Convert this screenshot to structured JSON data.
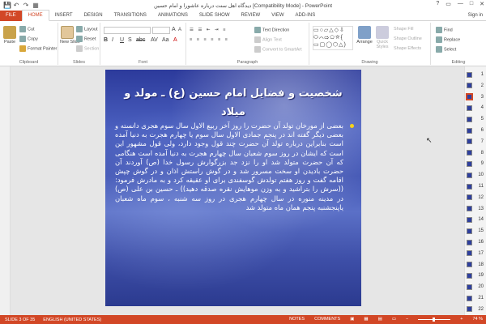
{
  "window": {
    "title": "دیدگاه اهل سنت درباره عاشورا و امام حسین [Compatibility Mode] - PowerPoint",
    "controls": [
      "?",
      "▭",
      "—",
      "□",
      "✕"
    ]
  },
  "qat": [
    "💾",
    "↶",
    "↷",
    "▦"
  ],
  "tabs": [
    "FILE",
    "HOME",
    "INSERT",
    "DESIGN",
    "TRANSITIONS",
    "ANIMATIONS",
    "SLIDE SHOW",
    "REVIEW",
    "VIEW",
    "ADD-INS"
  ],
  "signin": "Sign in",
  "ribbon": {
    "clipboard": {
      "paste": "Paste",
      "cut": "Cut",
      "copy": "Copy",
      "format_painter": "Format Painter",
      "label": "Clipboard"
    },
    "slides": {
      "new_slide": "New Slide",
      "layout": "Layout",
      "reset": "Reset",
      "section": "Section",
      "label": "Slides"
    },
    "font": {
      "label": "Font"
    },
    "paragraph": {
      "text_direction": "Text Direction",
      "align_text": "Align Text",
      "convert_smartart": "Convert to SmartArt",
      "label": "Paragraph"
    },
    "drawing": {
      "arrange": "Arrange",
      "quick_styles": "Quick Styles",
      "shape_fill": "Shape Fill",
      "shape_outline": "Shape Outline",
      "shape_effects": "Shape Effects",
      "label": "Drawing"
    },
    "editing": {
      "find": "Find",
      "replace": "Replace",
      "select": "Select",
      "label": "Editing"
    }
  },
  "slide": {
    "title": "شخصیت و فضایل امام حسین (ع) ـ مولد و میلاد",
    "body": "بعضی از مورخان تولد آن حضرت را روز آخر ربیع الاول سال سوم هجری دانسته و بعضی دیگر گفته اند در پنجم جمادی الاول سال سوم یا چهارم هجرت به دنیا آمده است بنابراین درباره تولد آن حضرت چند قول وجود دارد، ولی قول مشهور این است که ایشان در روز سوم شعبان سال چهارم هجرت به دنیا آمده است هنگامی که آن حضرت متولد شد او را نزد جد بزرگوارش رسول خدا (ص) آوردند آن حضرت بادیدن او سخت مسرور شد و در گوش راستش اذان و در گوش چپش اقامه گفت و روز هفتم تولدش گوسفندی برای او عقیقه کرد و به مادرش فرمود: ((سرش را بتراشید و به وزن موهایش نقره صدقه دهید)) ـ حسین بن علی (ص) در مدینه منوره در سال چهارم هجری در روز سه شنبه ، سوم ماه شعبان یاپنجشنبه پنجم همان ماه متولد شد"
  },
  "thumbnails": [
    "1",
    "2",
    "3",
    "4",
    "5",
    "6",
    "7",
    "8",
    "9",
    "10",
    "11",
    "12",
    "13",
    "14",
    "15",
    "16",
    "17",
    "18",
    "19",
    "20",
    "21",
    "22"
  ],
  "selected_thumbnail": "3",
  "status": {
    "slide": "SLIDE 3 OF 35",
    "language": "ENGLISH (UNITED STATES)",
    "notes": "NOTES",
    "comments": "COMMENTS",
    "zoom": "74 %"
  },
  "colors": {
    "accent": "#d24726",
    "slide_blue": "#3f53b3",
    "bullet": "#f7d21a"
  }
}
